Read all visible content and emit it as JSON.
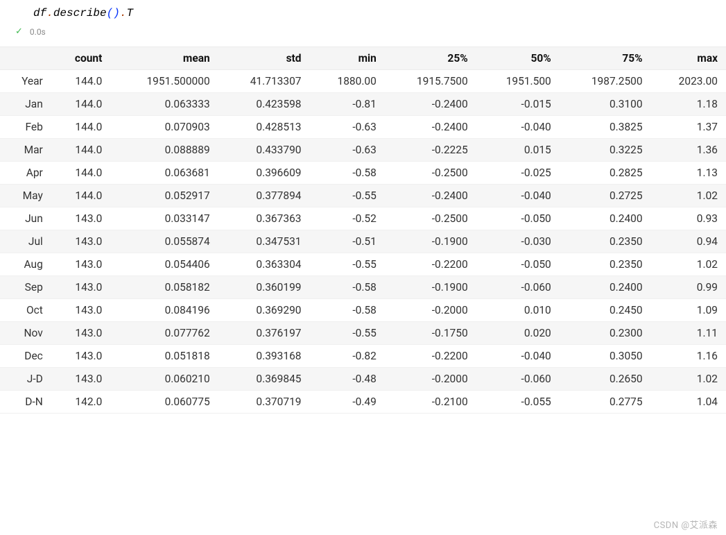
{
  "code": {
    "obj": "df",
    "dot1": ".",
    "method1": "describe",
    "paren_open1": "(",
    "paren_close1": ")",
    "dot2": ".",
    "attr": "T"
  },
  "status": {
    "time": "0.0s"
  },
  "table": {
    "headers": [
      "",
      "count",
      "mean",
      "std",
      "min",
      "25%",
      "50%",
      "75%",
      "max"
    ],
    "rows": [
      {
        "label": "Year",
        "cells": [
          "144.0",
          "1951.500000",
          "41.713307",
          "1880.00",
          "1915.7500",
          "1951.500",
          "1987.2500",
          "2023.00"
        ]
      },
      {
        "label": "Jan",
        "cells": [
          "144.0",
          "0.063333",
          "0.423598",
          "-0.81",
          "-0.2400",
          "-0.015",
          "0.3100",
          "1.18"
        ]
      },
      {
        "label": "Feb",
        "cells": [
          "144.0",
          "0.070903",
          "0.428513",
          "-0.63",
          "-0.2400",
          "-0.040",
          "0.3825",
          "1.37"
        ]
      },
      {
        "label": "Mar",
        "cells": [
          "144.0",
          "0.088889",
          "0.433790",
          "-0.63",
          "-0.2225",
          "0.015",
          "0.3225",
          "1.36"
        ]
      },
      {
        "label": "Apr",
        "cells": [
          "144.0",
          "0.063681",
          "0.396609",
          "-0.58",
          "-0.2500",
          "-0.025",
          "0.2825",
          "1.13"
        ]
      },
      {
        "label": "May",
        "cells": [
          "144.0",
          "0.052917",
          "0.377894",
          "-0.55",
          "-0.2400",
          "-0.040",
          "0.2725",
          "1.02"
        ]
      },
      {
        "label": "Jun",
        "cells": [
          "143.0",
          "0.033147",
          "0.367363",
          "-0.52",
          "-0.2500",
          "-0.050",
          "0.2400",
          "0.93"
        ]
      },
      {
        "label": "Jul",
        "cells": [
          "143.0",
          "0.055874",
          "0.347531",
          "-0.51",
          "-0.1900",
          "-0.030",
          "0.2350",
          "0.94"
        ]
      },
      {
        "label": "Aug",
        "cells": [
          "143.0",
          "0.054406",
          "0.363304",
          "-0.55",
          "-0.2200",
          "-0.050",
          "0.2350",
          "1.02"
        ]
      },
      {
        "label": "Sep",
        "cells": [
          "143.0",
          "0.058182",
          "0.360199",
          "-0.58",
          "-0.1900",
          "-0.060",
          "0.2400",
          "0.99"
        ]
      },
      {
        "label": "Oct",
        "cells": [
          "143.0",
          "0.084196",
          "0.369290",
          "-0.58",
          "-0.2000",
          "0.010",
          "0.2450",
          "1.09"
        ]
      },
      {
        "label": "Nov",
        "cells": [
          "143.0",
          "0.077762",
          "0.376197",
          "-0.55",
          "-0.1750",
          "0.020",
          "0.2300",
          "1.11"
        ]
      },
      {
        "label": "Dec",
        "cells": [
          "143.0",
          "0.051818",
          "0.393168",
          "-0.82",
          "-0.2200",
          "-0.040",
          "0.3050",
          "1.16"
        ]
      },
      {
        "label": "J-D",
        "cells": [
          "143.0",
          "0.060210",
          "0.369845",
          "-0.48",
          "-0.2000",
          "-0.060",
          "0.2650",
          "1.02"
        ]
      },
      {
        "label": "D-N",
        "cells": [
          "142.0",
          "0.060775",
          "0.370719",
          "-0.49",
          "-0.2100",
          "-0.055",
          "0.2775",
          "1.04"
        ]
      }
    ]
  },
  "watermark": "CSDN @艾派森"
}
